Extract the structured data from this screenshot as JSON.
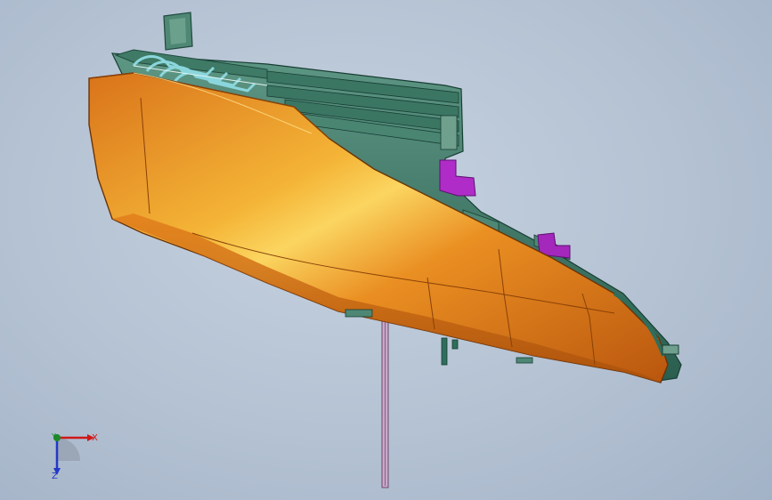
{
  "viewport": {
    "background_colors": [
      "#c6d2e0",
      "#a3b3c7"
    ]
  },
  "model": {
    "name_icon": "headlamp-housing-3d-model",
    "colors": {
      "lens": "#e8861a",
      "lens_highlight": "#f6c84a",
      "housing": "#2f6e5c",
      "housing_light": "#6fa08e",
      "clips": "#8ad6dc",
      "bracket": "#b02cc8",
      "rod": "#c9a8c9"
    }
  },
  "triad": {
    "x_label": "X",
    "y_label": "Y",
    "z_label": "Z",
    "colors": {
      "x": "#d01818",
      "y": "#1c8a2a",
      "z": "#2438c8"
    }
  }
}
